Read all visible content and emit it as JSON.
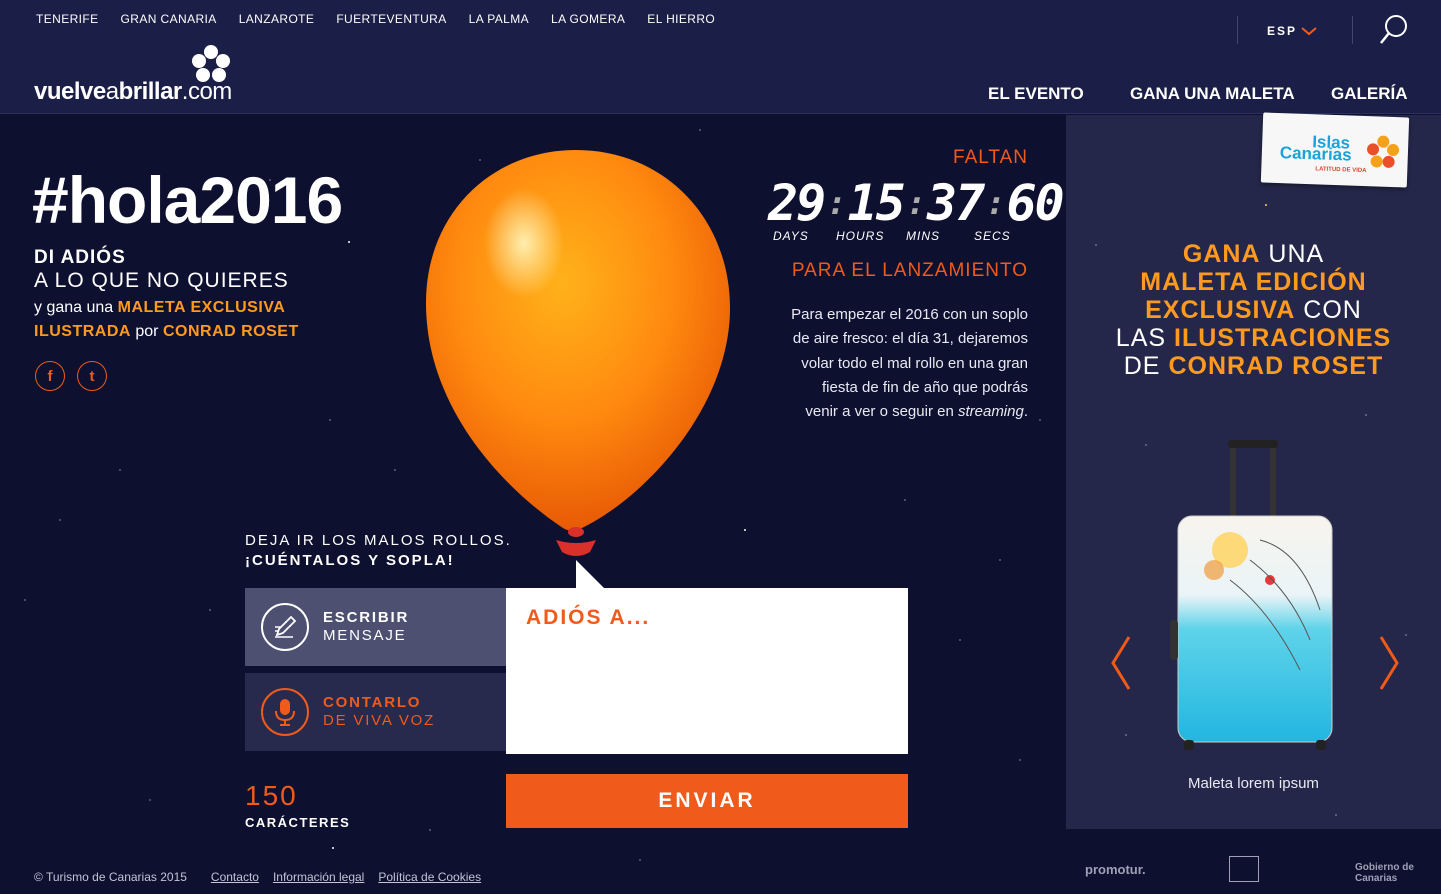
{
  "topnav": [
    "TENERIFE",
    "GRAN CANARIA",
    "LANZAROTE",
    "FUERTEVENTURA",
    "LA PALMA",
    "LA GOMERA",
    "EL HIERRO"
  ],
  "lang": "ESP",
  "logo": {
    "a": "vuelve",
    "b": "a",
    "c": "brillar",
    "d": ".com"
  },
  "mainnav": [
    "EL EVENTO",
    "GANA UNA MALETA",
    "GALERÍA"
  ],
  "hero": {
    "hashtag": "#hola2016",
    "line1": "DI ADIÓS",
    "line2": "A LO QUE NO QUIERES",
    "p1": "y gana una ",
    "p2": "MALETA EXCLUSIVA",
    "p3": "ILUSTRADA",
    "p4": " por ",
    "p5": "CONRAD ROSET"
  },
  "social": {
    "facebook": "f",
    "twitter": "t"
  },
  "countdown": {
    "faltan": "FALTAN",
    "days": "29",
    "hours": "15",
    "mins": "37",
    "secs": "60",
    "days_label": "DAYS",
    "hours_label": "HOURS",
    "mins_label": "MINS",
    "secs_label": "SECS",
    "para": "PARA EL LANZAMIENTO"
  },
  "description": {
    "text": "Para empezar el 2016 con un soplo de aire fresco: el día 31, dejaremos volar todo el mal rollo en una gran fiesta de fin de año que podrás venir a ver o seguir en ",
    "emph": "streaming",
    "end": "."
  },
  "form": {
    "deja": "DEJA IR LOS MALOS ROLLOS.",
    "cuent": "¡CUÉNTALOS Y SOPLA!",
    "opt1_a": "ESCRIBIR",
    "opt1_b": "MENSAJE",
    "opt2_a": "CONTARLO",
    "opt2_b": "DE VIVA VOZ",
    "placeholder": "ADIÓS A...",
    "count": "150",
    "count_label": "CARÁCTERES",
    "send": "ENVIAR"
  },
  "promo": {
    "badge_1": "Islas",
    "badge_2": "Canarias",
    "badge_3": "LATITUD DE VIDA",
    "l1a": "GANA",
    "l1b": " UNA",
    "l2": "MALETA EDICIÓN",
    "l3a": "EXCLUSIVA",
    "l3b": " CON",
    "l4a": "LAS ",
    "l4b": "ILUSTRACIONES",
    "l5a": "DE ",
    "l5b": "CONRAD ROSET",
    "caption": "Maleta lorem ipsum"
  },
  "footer": {
    "copy": "© Turismo de Canarias 2015",
    "links": [
      "Contacto",
      "Información legal",
      "Política de Cookies"
    ],
    "logo1": "promotur.",
    "logo2": "Gobierno de Canarias"
  },
  "colors": {
    "bg": "#0e1030",
    "header": "#1b1e46",
    "accent": "#f05a1a",
    "gold": "#ff9a1f",
    "panel": "#242749"
  }
}
